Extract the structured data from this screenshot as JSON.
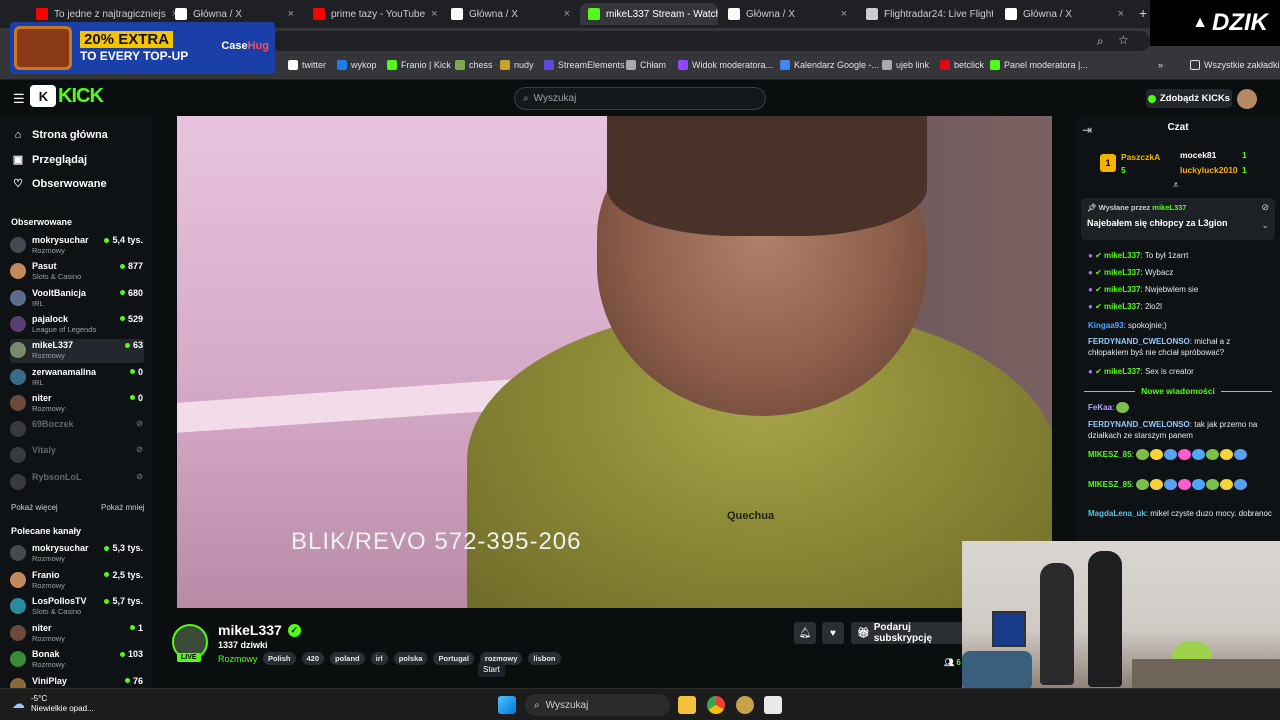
{
  "browser": {
    "tabs": [
      {
        "title": "To jedne z najtragiczniejs",
        "color": "#ff0000",
        "active": false
      },
      {
        "title": "Główna / X",
        "color": "#ffffff",
        "active": false
      },
      {
        "title": "prime tazy - YouTube",
        "color": "#ff0000",
        "active": false
      },
      {
        "title": "Główna / X",
        "color": "#ffffff",
        "active": false
      },
      {
        "title": "mikeL337 Stream - Watch",
        "color": "#53fc18",
        "active": true
      },
      {
        "title": "Główna / X",
        "color": "#ffffff",
        "active": false
      },
      {
        "title": "Flightradar24: Live Flight",
        "color": "#cccccc",
        "active": false
      },
      {
        "title": "Główna / X",
        "color": "#ffffff",
        "active": false
      }
    ],
    "tab_close": "×",
    "new_tab": "+",
    "bookmarks": [
      {
        "label": "twitter",
        "color": "#ffffff"
      },
      {
        "label": "wykop",
        "color": "#1f7ee6"
      },
      {
        "label": "Franio | Kick",
        "color": "#53fc18"
      },
      {
        "label": "chess",
        "color": "#7fa650"
      },
      {
        "label": "nudy",
        "color": "#c9a227"
      },
      {
        "label": "StreamElements",
        "color": "#5b4bdb"
      },
      {
        "label": "Chłam",
        "color": "#aaaaaa"
      },
      {
        "label": "Widok moderatora...",
        "color": "#9147ff"
      },
      {
        "label": "Kalendarz Google -...",
        "color": "#4285f4"
      },
      {
        "label": "ujeb link",
        "color": "#aaaaaa"
      },
      {
        "label": "betclick",
        "color": "#e30613"
      },
      {
        "label": "Panel moderatora |...",
        "color": "#53fc18"
      }
    ],
    "bookmarks_more": "»",
    "all_bookmarks": "Wszystkie zakładki"
  },
  "ad": {
    "line1": "20% EXTRA",
    "line2": "TO EVERY TOP-UP",
    "brand_a": "Case",
    "brand_b": "Hug"
  },
  "overlay_brand": "DZIK",
  "header": {
    "logo": "KICK",
    "search_placeholder": "Wyszukaj",
    "get_kicks": "Zdobądź KICKs"
  },
  "nav": [
    {
      "label": "Strona główna",
      "icon": "home-icon"
    },
    {
      "label": "Przeglądaj",
      "icon": "browse-icon"
    },
    {
      "label": "Obserwowane",
      "icon": "heart-icon"
    }
  ],
  "followed": {
    "title": "Obserwowane",
    "channels": [
      {
        "name": "mokrysuchar",
        "cat": "Rozmowy",
        "viewers": "5,4 tys.",
        "color": "#444a50",
        "live": true
      },
      {
        "name": "Pasut",
        "cat": "Slots & Casino",
        "viewers": "877",
        "color": "#c28a5a",
        "live": true
      },
      {
        "name": "VooltBanicja",
        "cat": "IRL",
        "viewers": "680",
        "color": "#5a6c8a",
        "live": true
      },
      {
        "name": "pajalock",
        "cat": "League of Legends",
        "viewers": "529",
        "color": "#5a3e6e",
        "live": true
      },
      {
        "name": "mikeL337",
        "cat": "Rozmowy",
        "viewers": "63",
        "color": "#7a8a6a",
        "live": true
      },
      {
        "name": "zerwanamalina",
        "cat": "IRL",
        "viewers": "0",
        "color": "#3a6a8a",
        "live": true
      },
      {
        "name": "niter",
        "cat": "Rozmowy",
        "viewers": "0",
        "color": "#6a4a3a",
        "live": true
      },
      {
        "name": "69Boczek",
        "cat": "",
        "viewers": "",
        "color": "#888888",
        "live": false
      },
      {
        "name": "Vitaly",
        "cat": "",
        "viewers": "",
        "color": "#888888",
        "live": false
      },
      {
        "name": "RybsonLoL",
        "cat": "",
        "viewers": "",
        "color": "#888888",
        "live": false
      }
    ],
    "show_more": "Pokaż więcej",
    "show_less": "Pokaż mniej"
  },
  "recommended": {
    "title": "Polecane kanały",
    "channels": [
      {
        "name": "mokrysuchar",
        "cat": "Rozmowy",
        "viewers": "5,3 tys.",
        "color": "#444a50"
      },
      {
        "name": "Franio",
        "cat": "Rozmowy",
        "viewers": "2,5 tys.",
        "color": "#c28a5a"
      },
      {
        "name": "LosPollosTV",
        "cat": "Slots & Casino",
        "viewers": "5,7 tys.",
        "color": "#2a8aa0"
      },
      {
        "name": "niter",
        "cat": "Rozmowy",
        "viewers": "1",
        "color": "#6a4a3a"
      },
      {
        "name": "Bonak",
        "cat": "Rozmowy",
        "viewers": "103",
        "color": "#3a8a3a"
      },
      {
        "name": "ViniPlay",
        "cat": "",
        "viewers": "76",
        "color": "#8a6a3a"
      }
    ]
  },
  "video": {
    "overlay_text": "BLIK/REVO  572-395-206",
    "jacket_brand": "Quechua"
  },
  "stream": {
    "name": "mikeL337",
    "followers": "1337 dziwki",
    "category": "Rozmowy",
    "live": "LIVE",
    "tags": [
      "Polish",
      "420",
      "poland",
      "irl",
      "polska",
      "Portugal",
      "rozmowy",
      "lisbon"
    ],
    "subscribe": "Podaruj subskrypcję",
    "tooltip": "Start",
    "viewers_partial": "6"
  },
  "chat": {
    "title": "Czat",
    "leaderboard": [
      {
        "rank": "1",
        "user": "PaszczkA",
        "value": "5"
      },
      {
        "user": "mocek81",
        "value": "1"
      },
      {
        "user": "luckyluck2010",
        "value": "1"
      }
    ],
    "pinned": {
      "by_label": "Wysłane przez",
      "by_user": "mikeL337",
      "message": "Najebałem się chłopcy za L3gion"
    },
    "messages": [
      {
        "user": "mikeL337",
        "text": "To był 1zarrt",
        "color": "#53fc18"
      },
      {
        "user": "mikeL337",
        "text": "Wybacz",
        "color": "#53fc18"
      },
      {
        "user": "mikeL337",
        "text": "Nwjebwlem sie",
        "color": "#53fc18"
      },
      {
        "user": "mikeL337",
        "text": "2lo2l",
        "color": "#53fc18"
      },
      {
        "user": "Kingaa93",
        "text": "spokojnie;)",
        "color": "#4ea7ff"
      },
      {
        "user": "FERDYNAND_CWELONSO",
        "text": "michał a z chłopakiem byś nie chciał spróbować?",
        "color": "#8ecbff"
      },
      {
        "user": "mikeL337",
        "text": "Sex is creator",
        "color": "#53fc18"
      }
    ],
    "new_messages": "Nowe wiadomości",
    "messages2": [
      {
        "user": "FeKaa",
        "text": "",
        "color": "#b7a3ff"
      },
      {
        "user": "FERDYNAND_CWELONSO",
        "text": "tak jak przemo na działkach ze starszym panem",
        "color": "#8ecbff"
      },
      {
        "user": "MIKESZ_85",
        "text": "",
        "color": "#53fc18"
      },
      {
        "user": "MIKESZ_85",
        "text": "",
        "color": "#53fc18"
      },
      {
        "user": "MagdaLena_uk",
        "text": "mikel czyste duzo mocy. dobranoc",
        "color": "#5bc0de"
      }
    ]
  },
  "taskbar": {
    "temp": "-5°C",
    "weather": "Niewielkie opad...",
    "search": "Wyszukaj"
  }
}
